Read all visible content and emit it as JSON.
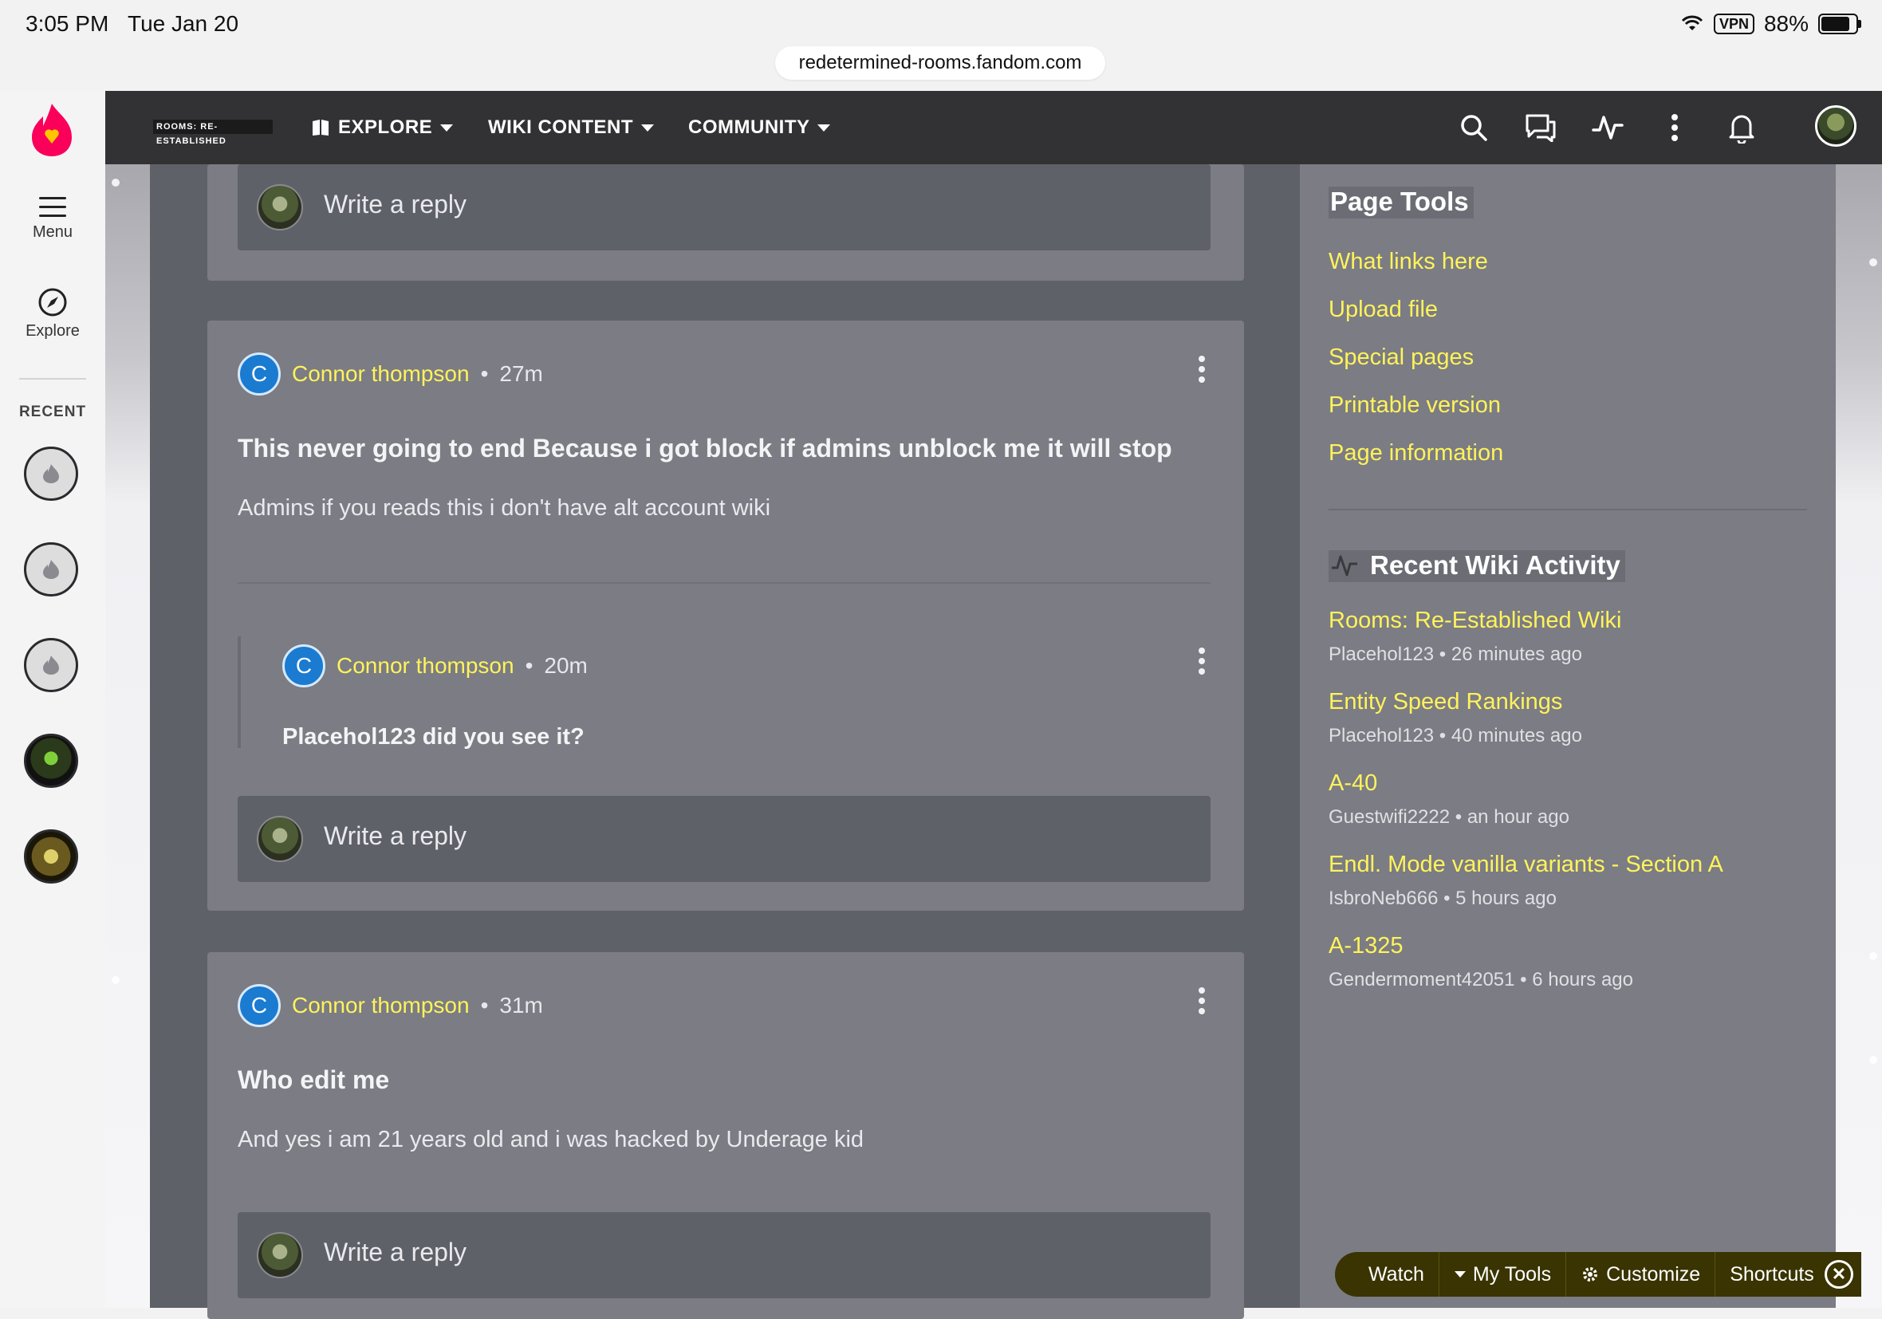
{
  "status_bar": {
    "time": "3:05 PM",
    "date": "Tue Jan 20",
    "vpn": "VPN",
    "battery": "88%"
  },
  "browser": {
    "url": "redetermined-rooms.fandom.com"
  },
  "rail": {
    "menu_label": "Menu",
    "explore_label": "Explore",
    "recent_label": "RECENT"
  },
  "topnav": {
    "wordmark": "ROOMS: RE-ESTABLISHED",
    "explore": "EXPLORE",
    "wiki_content": "WIKI CONTENT",
    "community": "COMMUNITY"
  },
  "thread": {
    "top_reply_placeholder": "Write a reply",
    "posts": [
      {
        "author": "Connor thompson",
        "avatar_letter": "C",
        "age": "27m",
        "title": "This never going to end Because i got block if admins unblock me it will stop",
        "body": "Admins if you reads this i don't have alt account wiki",
        "reply": {
          "author": "Connor thompson",
          "avatar_letter": "C",
          "age": "20m",
          "title": "Placehol123 did you see it?"
        },
        "reply_placeholder": "Write a reply"
      },
      {
        "author": "Connor thompson",
        "avatar_letter": "C",
        "age": "31m",
        "title": "Who edit me",
        "body": "And yes i am 21 years old and i was hacked by Underage kid",
        "reply_placeholder": "Write a reply"
      }
    ]
  },
  "page_tools": {
    "title": "Page Tools",
    "links": [
      "What links here",
      "Upload file",
      "Special pages",
      "Printable version",
      "Page information"
    ]
  },
  "recent_activity": {
    "title": "Recent Wiki Activity",
    "items": [
      {
        "page": "Rooms: Re-Established Wiki",
        "meta": "Placehol123 • 26 minutes ago"
      },
      {
        "page": "Entity Speed Rankings",
        "meta": "Placehol123 • 40 minutes ago"
      },
      {
        "page": "A-40",
        "meta": "Guestwifi2222 • an hour ago"
      },
      {
        "page": "Endl. Mode vanilla variants - Section A",
        "meta": "IsbroNeb666 • 5 hours ago"
      },
      {
        "page": "A-1325",
        "meta": "Gendermoment42051 • 6 hours ago"
      }
    ]
  },
  "toolbar": {
    "watch": "Watch",
    "my_tools": "My Tools",
    "customize": "Customize",
    "shortcuts": "Shortcuts"
  },
  "colors": {
    "link_yellow": "#fff35a",
    "nav_bg": "#323234",
    "fandom_pink": "#fa005a",
    "avatar_blue": "#1a7bd1"
  }
}
